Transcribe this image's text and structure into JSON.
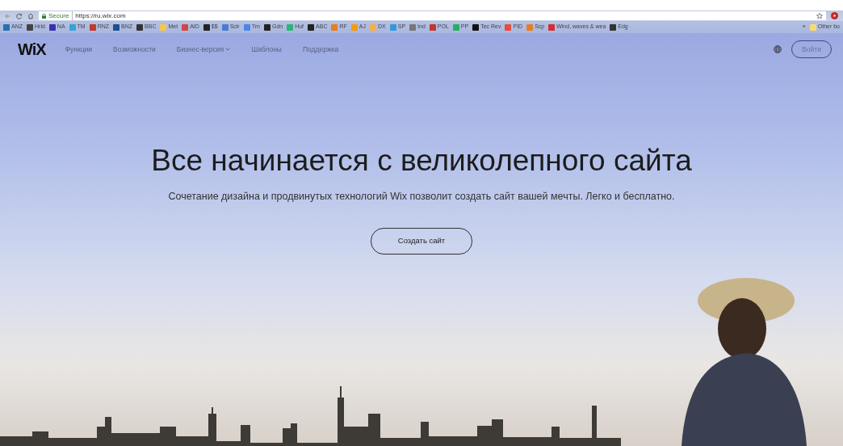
{
  "browser": {
    "security_label": "Secure",
    "url": "https://ru.wix.com",
    "bookmarks": [
      {
        "label": "ANZ",
        "color": "#2a6fb0"
      },
      {
        "label": "Hrld",
        "color": "#444444"
      },
      {
        "label": "NA",
        "color": "#3b2fb0"
      },
      {
        "label": "TM",
        "color": "#3aa0d8"
      },
      {
        "label": "RNZ",
        "color": "#c0392b"
      },
      {
        "label": "BNZ",
        "color": "#1f4f8f"
      },
      {
        "label": "BBC",
        "color": "#333333"
      },
      {
        "label": "Met",
        "color": "#f2c94c"
      },
      {
        "label": "AID",
        "color": "#d64545"
      },
      {
        "label": "$$",
        "color": "#222222"
      },
      {
        "label": "Sclr",
        "color": "#4a7bd0"
      },
      {
        "label": "Trn",
        "color": "#4a86e8"
      },
      {
        "label": "Gdn",
        "color": "#222222"
      },
      {
        "label": "Huf",
        "color": "#2bb673"
      },
      {
        "label": "ABC",
        "color": "#222222"
      },
      {
        "label": "RF",
        "color": "#e67e22"
      },
      {
        "label": "AJ",
        "color": "#f39c12"
      },
      {
        "label": "DX",
        "color": "#f5b041"
      },
      {
        "label": "SP",
        "color": "#3498db"
      },
      {
        "label": "Ind",
        "color": "#777777"
      },
      {
        "label": "POL",
        "color": "#c0392b"
      },
      {
        "label": "PP",
        "color": "#27ae60"
      },
      {
        "label": "Tec Rev",
        "color": "#111111"
      },
      {
        "label": "PID",
        "color": "#e74c3c"
      },
      {
        "label": "Scp",
        "color": "#e67e22"
      },
      {
        "label": "Wind, waves & wea",
        "color": "#d32f2f"
      },
      {
        "label": "Edg",
        "color": "#333333"
      }
    ],
    "more": "»",
    "other_bookmarks": "Other bo"
  },
  "site": {
    "logo": "WiX",
    "nav": [
      {
        "label": "Функции",
        "dropdown": false
      },
      {
        "label": "Возможности",
        "dropdown": false
      },
      {
        "label": "Бизнес-версия",
        "dropdown": true
      },
      {
        "label": "Шаблоны",
        "dropdown": false
      },
      {
        "label": "Поддержка",
        "dropdown": false
      }
    ],
    "login": "Войти",
    "headline": "Все начинается с великолепного сайта",
    "subheadline": "Сочетание дизайна и продвинутых технологий Wix позволит создать сайт вашей мечты. Легко и бесплатно.",
    "cta": "Создать сайт"
  }
}
